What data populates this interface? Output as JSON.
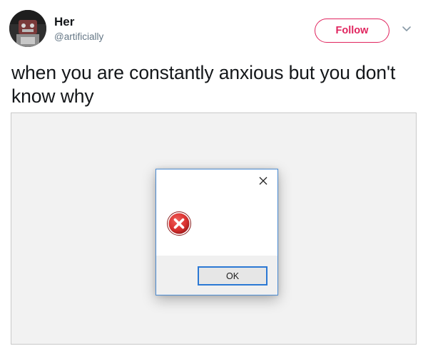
{
  "tweet": {
    "author": {
      "display_name": "Her",
      "handle": "@artificially"
    },
    "follow_label": "Follow",
    "text": "when you are constantly anxious but you don't know why",
    "colors": {
      "accent": "#e0245e",
      "text": "#14171a",
      "muted": "#657786"
    }
  },
  "media": {
    "dialog": {
      "close_icon": "close-icon",
      "status_icon": "error-icon",
      "ok_label": "OK",
      "colors": {
        "border": "#4b8bd1",
        "error_red": "#d9302f",
        "footer": "#f0f0f0"
      }
    }
  }
}
